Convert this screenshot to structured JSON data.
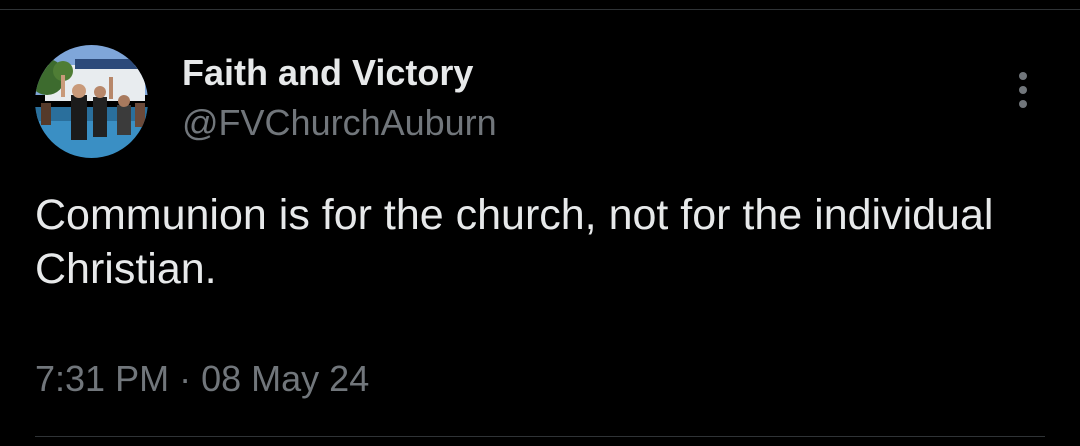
{
  "author": {
    "display_name": "Faith and Victory",
    "handle": "@FVChurchAuburn",
    "avatar_icon": "profile-photo"
  },
  "tweet": {
    "text": "Communion is for the church, not for the individual Christian.",
    "time": "7:31 PM",
    "separator": "·",
    "date": "08 May 24"
  },
  "actions": {
    "more_icon": "more-vertical-icon"
  },
  "colors": {
    "background": "#000000",
    "primary_text": "#e7e9ea",
    "secondary_text": "#71767b",
    "divider": "#2f3336"
  }
}
